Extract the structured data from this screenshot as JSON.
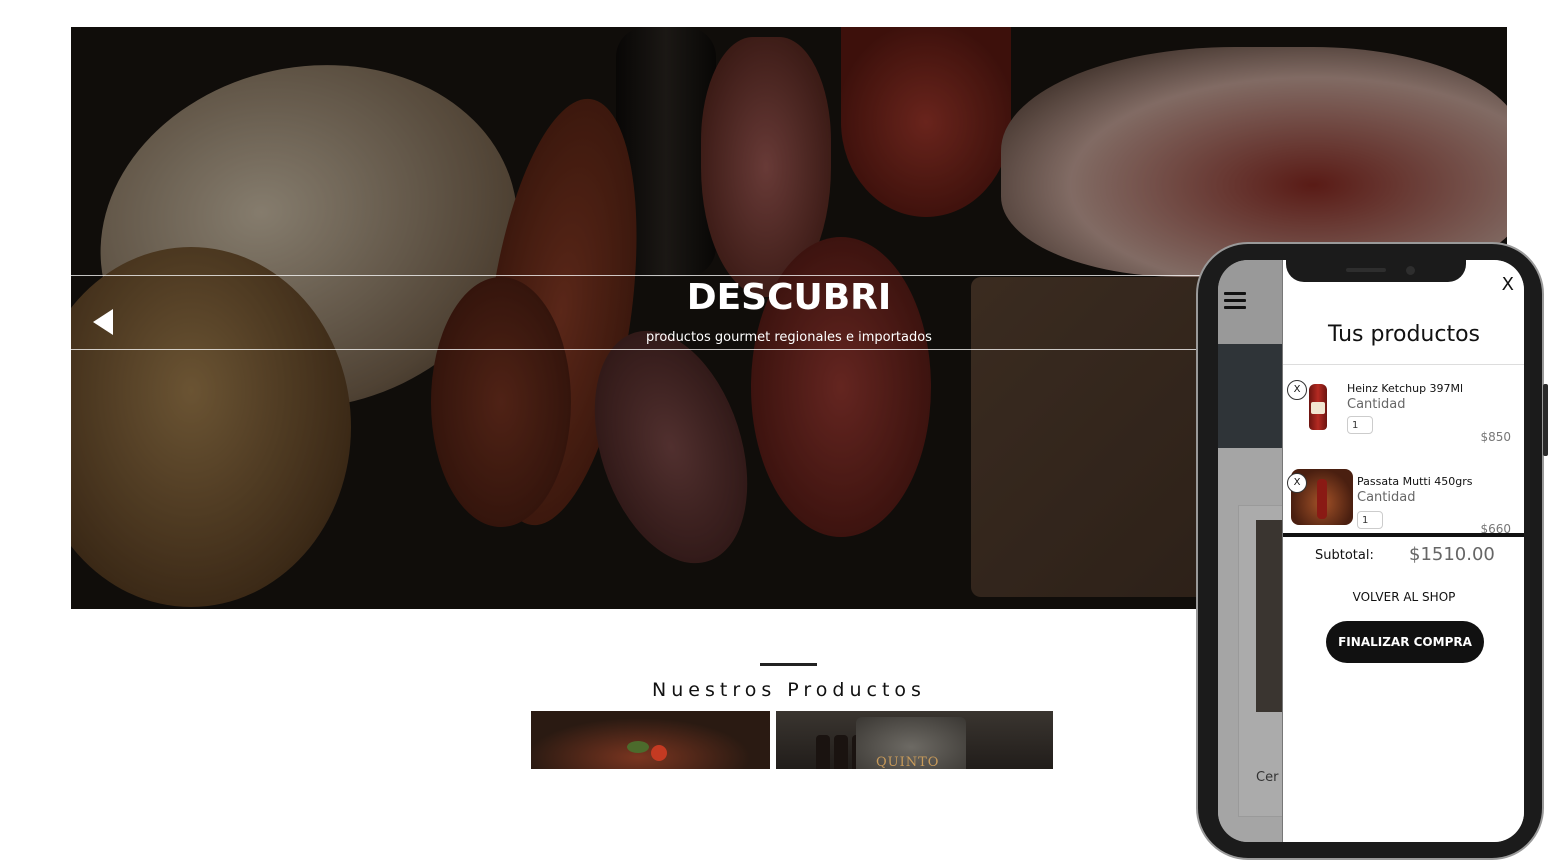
{
  "hero": {
    "title": "DESCUBRI",
    "subtitle": "productos gourmet regionales e importados"
  },
  "products_section": {
    "title": "Nuestros Productos",
    "card_brand": "QUINTO"
  },
  "mobile": {
    "background_text": "Cer",
    "cart": {
      "close_label": "X",
      "heading": "Tus productos",
      "remove_label": "X",
      "quantity_label": "Cantidad",
      "items": [
        {
          "name": "Heinz Ketchup 397Ml",
          "quantity": "1",
          "price": "$850"
        },
        {
          "name": "Passata Mutti 450grs",
          "quantity": "1",
          "price": "$660"
        }
      ],
      "subtotal_label": "Subtotal:",
      "subtotal_value": "$1510.00",
      "back_label": "VOLVER AL SHOP",
      "checkout_label": "FINALIZAR COMPRA"
    }
  },
  "colors": {
    "accent": "#111111",
    "price_gray": "#777777"
  }
}
